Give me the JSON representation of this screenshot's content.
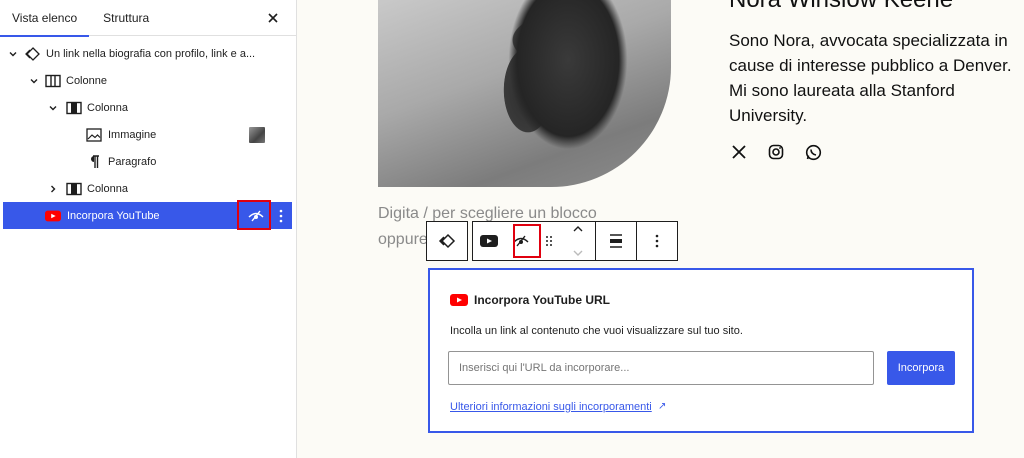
{
  "sidebar": {
    "tabs": [
      {
        "label": "Vista elenco",
        "active": true
      },
      {
        "label": "Struttura",
        "active": false
      }
    ],
    "close_icon": "close-icon",
    "tree": [
      {
        "label": "Un link nella biografia con profilo, link e a...",
        "icon": "pattern-diamond-icon",
        "expanded": true,
        "depth": 0
      },
      {
        "label": "Colonne",
        "icon": "columns-icon",
        "expanded": true,
        "depth": 1
      },
      {
        "label": "Colonna",
        "icon": "column-icon",
        "expanded": true,
        "depth": 2
      },
      {
        "label": "Immagine",
        "icon": "image-icon",
        "depth": 3
      },
      {
        "label": "Paragrafo",
        "icon": "paragraph-icon",
        "depth": 3
      },
      {
        "label": "Colonna",
        "icon": "column-icon",
        "expanded": false,
        "depth": 2
      },
      {
        "label": "Incorpora YouTube",
        "icon": "youtube-icon",
        "selected": true,
        "depth": 1
      }
    ]
  },
  "canvas": {
    "name": "Nora Winslow Keene",
    "bio": "Sono Nora, avvocata specializzata in cause di interesse pubblico a Denver. Mi sono laureata alla Stanford University.",
    "social_icons": [
      "x-icon",
      "instagram-icon",
      "whatsapp-icon"
    ],
    "placeholder_line1": "Digita / per scegliere un blocco",
    "placeholder_line2": "oppure"
  },
  "embed": {
    "title": "Incorpora YouTube URL",
    "description": "Incolla un link al contenuto che vuoi visualizzare sul tuo sito.",
    "input_placeholder": "Inserisci qui l'URL da incorporare...",
    "input_value": "",
    "submit_label": "Incorpora",
    "learn_more": "Ulteriori informazioni sugli incorporamenti",
    "learn_more_arrow": "↗"
  },
  "colors": {
    "accent": "#3858e9",
    "highlight_box": "#e0000f",
    "youtube_red": "#ff0000"
  }
}
